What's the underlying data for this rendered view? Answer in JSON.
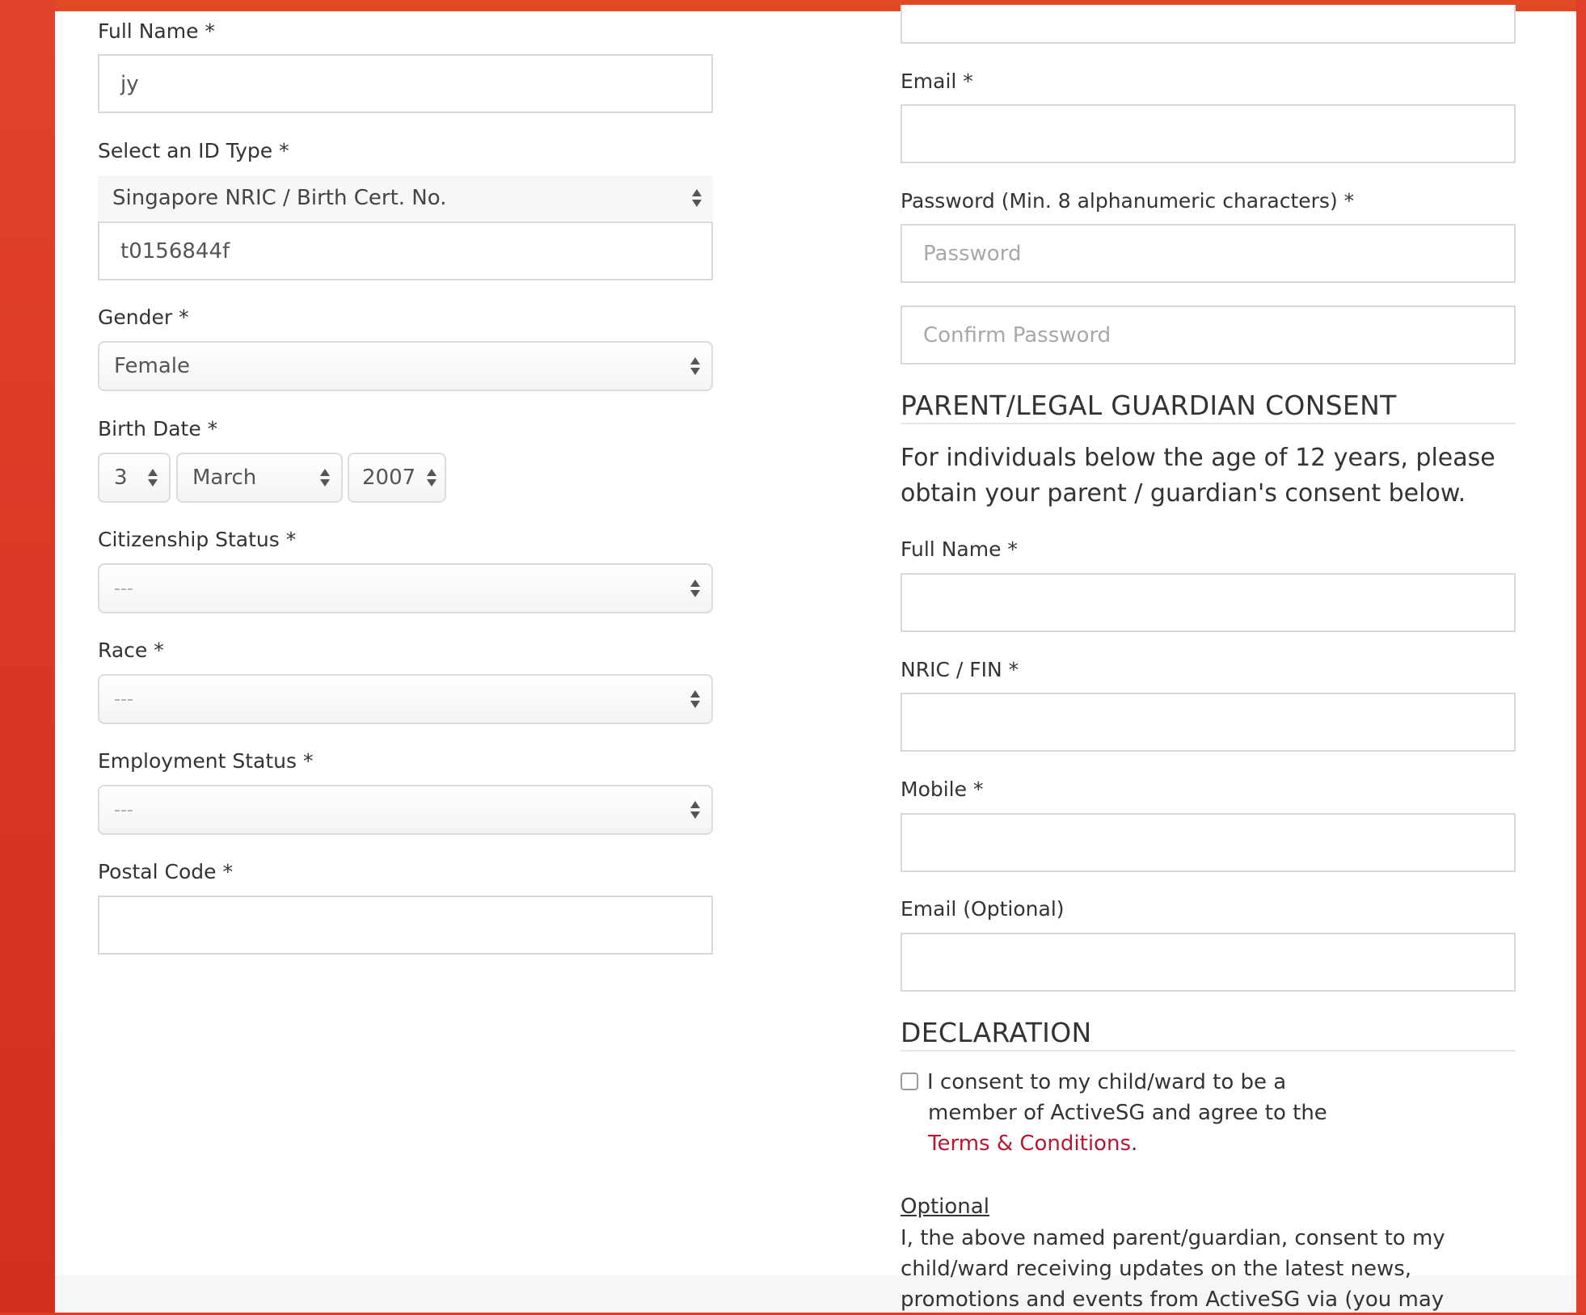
{
  "left": {
    "full_name_label": "Full Name *",
    "full_name_value": "jy",
    "id_type_label": "Select an ID Type *",
    "id_type_value": "Singapore NRIC / Birth Cert. No.",
    "id_number_value": "t0156844f",
    "gender_label": "Gender *",
    "gender_value": "Female",
    "birth_date_label": "Birth Date *",
    "birth_day": "3",
    "birth_month": "March",
    "birth_year": "2007",
    "citizenship_label": "Citizenship Status *",
    "citizenship_value": "---",
    "race_label": "Race *",
    "race_value": "---",
    "employment_label": "Employment Status *",
    "employment_value": "---",
    "postal_label": "Postal Code *",
    "postal_value": ""
  },
  "right": {
    "email_label": "Email *",
    "email_value": "",
    "password_label": "Password (Min. 8 alphanumeric characters) *",
    "password_placeholder": "Password",
    "confirm_placeholder": "Confirm Password",
    "consent_heading": "PARENT/LEGAL GUARDIAN CONSENT",
    "consent_text_line1": "For individuals below the age of 12 years, please",
    "consent_text_line2": "obtain your parent / guardian's consent below.",
    "guardian_name_label": "Full Name *",
    "guardian_nric_label": "NRIC / FIN *",
    "guardian_mobile_label": "Mobile *",
    "guardian_email_label": "Email (Optional)",
    "declaration_heading": "DECLARATION",
    "declaration_line1": "I consent to my child/ward to be a",
    "declaration_line2": "member of ActiveSG and agree to the",
    "terms_link": "Terms & Conditions",
    "terms_period": ".",
    "optional_label": "Optional",
    "optional_line1": "I, the above named parent/guardian, consent to my",
    "optional_line2": "child/ward receiving updates on the latest news,",
    "optional_line3": "promotions and events from ActiveSG via (you may"
  }
}
